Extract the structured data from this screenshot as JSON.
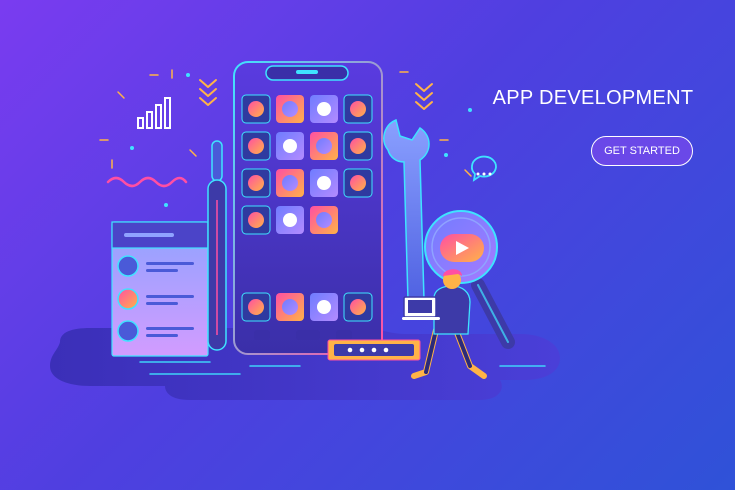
{
  "hero": {
    "title": "APP DEVELOPMENT",
    "cta_label": "GET STARTED"
  },
  "colors": {
    "background_start": "#7a3cf0",
    "background_end": "#2f52d8",
    "accent_cyan": "#3fe3ff",
    "accent_pink": "#ff4fa3",
    "accent_orange": "#ffb347",
    "cta_fill": "#6a48e8",
    "text": "#ffffff"
  },
  "icons": [
    "bar-chart-icon",
    "chevron-down-icon",
    "chat-bubble-icon",
    "play-icon",
    "wrench-icon",
    "screwdriver-icon",
    "magnifier-icon",
    "laptop-icon",
    "wave-icon"
  ]
}
